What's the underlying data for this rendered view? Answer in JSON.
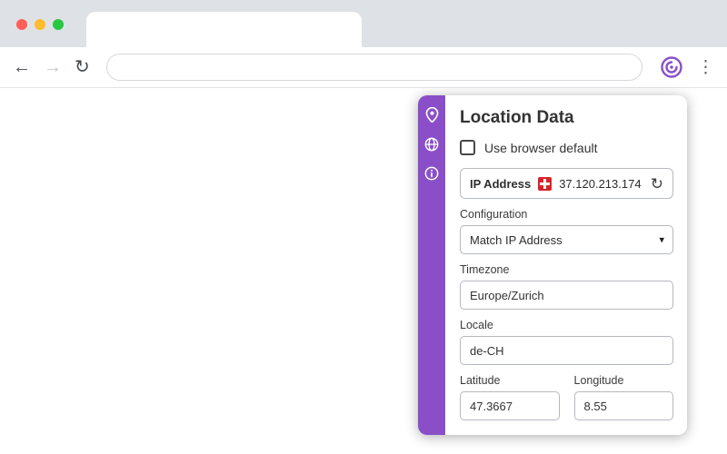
{
  "browser": {
    "tab_title": "",
    "address_value": "",
    "address_placeholder": ""
  },
  "icons": {
    "back": "←",
    "forward": "→",
    "reload": "↻",
    "menu": "⋮",
    "ip_refresh": "↻",
    "dropdown_caret": "▾"
  },
  "panel": {
    "title": "Location Data",
    "checkbox": {
      "label": "Use browser default",
      "checked": false
    },
    "ip": {
      "label": "IP Address",
      "value": "37.120.213.174",
      "flag": "switzerland"
    },
    "configuration": {
      "label": "Configuration",
      "value": "Match IP Address"
    },
    "timezone": {
      "label": "Timezone",
      "value": "Europe/Zurich"
    },
    "locale": {
      "label": "Locale",
      "value": "de-CH"
    },
    "latitude": {
      "label": "Latitude",
      "value": "47.3667"
    },
    "longitude": {
      "label": "Longitude",
      "value": "8.55"
    }
  },
  "colors": {
    "accent": "#8a4fc8",
    "flag_red": "#d8232a"
  }
}
